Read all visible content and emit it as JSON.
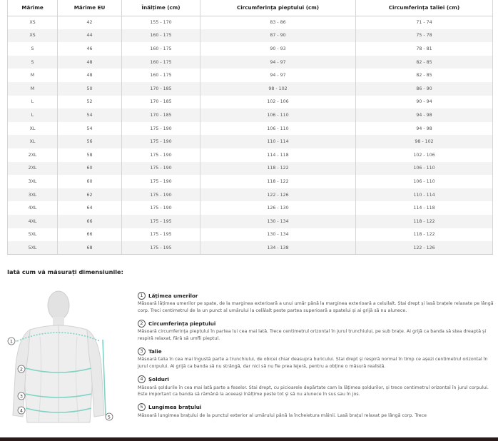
{
  "table": {
    "headers": [
      "Mărime",
      "Mărime EU",
      "Înălțime (cm)",
      "Circumferința pieptului (cm)",
      "Circumferința taliei (cm)"
    ],
    "rows": [
      [
        "XS",
        "42",
        "155 - 170",
        "83 - 86",
        "71 - 74"
      ],
      [
        "XS",
        "44",
        "160 - 175",
        "87 - 90",
        "75 - 78"
      ],
      [
        "S",
        "46",
        "160 - 175",
        "90 - 93",
        "78 - 81"
      ],
      [
        "S",
        "48",
        "160 - 175",
        "94 - 97",
        "82 - 85"
      ],
      [
        "M",
        "48",
        "160 - 175",
        "94 - 97",
        "82 - 85"
      ],
      [
        "M",
        "50",
        "170 - 185",
        "98 - 102",
        "86 - 90"
      ],
      [
        "L",
        "52",
        "170 - 185",
        "102 - 106",
        "90 - 94"
      ],
      [
        "L",
        "54",
        "170 - 185",
        "106 - 110",
        "94 - 98"
      ],
      [
        "XL",
        "54",
        "175 - 190",
        "106 - 110",
        "94 - 98"
      ],
      [
        "XL",
        "56",
        "175 - 190",
        "110 - 114",
        "98 - 102"
      ],
      [
        "2XL",
        "58",
        "175 - 190",
        "114 - 118",
        "102 - 106"
      ],
      [
        "2XL",
        "60",
        "175 - 190",
        "118 - 122",
        "106 - 110"
      ],
      [
        "3XL",
        "60",
        "175 - 190",
        "118 - 122",
        "106 - 110"
      ],
      [
        "3XL",
        "62",
        "175 - 190",
        "122 - 126",
        "110 - 114"
      ],
      [
        "4XL",
        "64",
        "175 - 190",
        "126 - 130",
        "114 - 118"
      ],
      [
        "4XL",
        "66",
        "175 - 195",
        "130 - 134",
        "118 - 122"
      ],
      [
        "5XL",
        "66",
        "175 - 195",
        "130 - 134",
        "118 - 122"
      ],
      [
        "5XL",
        "68",
        "175 - 195",
        "134 - 138",
        "122 - 126"
      ]
    ]
  },
  "guide": {
    "title": "Iată cum vă măsurați dimensiunile:",
    "figure_markers": [
      "1",
      "2",
      "3",
      "4",
      "5"
    ],
    "steps": [
      {
        "num": "1",
        "title": "Lățimea umerilor",
        "text": "Măsoară lățimea umerilor pe spate, de la marginea exterioară a unui umăr până la marginea exterioară a celuilalt. Stai drept și lasă brațele relaxate pe lângă corp. Treci centimetrul de la un punct al umărului la celălalt peste partea superioară a spatelui și ai grijă să nu alunece."
      },
      {
        "num": "2",
        "title": "Circumferința pieptului",
        "text": "Măsoară circumferința pieptului în partea lui cea mai lată. Trece centimetrul orizontal în jurul trunchiului, pe sub brațe. Ai grijă ca banda să stea dreaptă și respiră relaxat, fără să umfli pieptul."
      },
      {
        "num": "3",
        "title": "Talie",
        "text": "Măsoară talia în cea mai îngustă parte a trunchiului, de obicei chiar deasupra buricului. Stai drept și respiră normal în timp ce așezi centimetrul orizontal în jurul corpului. Ai grijă ca banda să nu strângă, dar nici să nu fie prea lejeră, pentru a obține o măsură realistă."
      },
      {
        "num": "4",
        "title": "Șolduri",
        "text": "Măsoară șoldurile în cea mai lată parte a feselor. Stai drept, cu picioarele depărtate cam la lățimea șoldurilor, și trece centimetrul orizontal în jurul corpului. Este important ca banda să rămână la aceeași înălțime peste tot și să nu alunece în sus sau în jos."
      },
      {
        "num": "5",
        "title": "Lungimea brațului",
        "text": "Măsoară lungimea brațului de la punctul exterior al umărului până la încheietura mâinii. Lasă brațul relaxat pe lângă corp. Trece"
      }
    ]
  },
  "colors": {
    "measure_line": "#7fd3c4",
    "row_alt": "#f3f3f3",
    "bottom_bar": "#2a1a1a"
  }
}
